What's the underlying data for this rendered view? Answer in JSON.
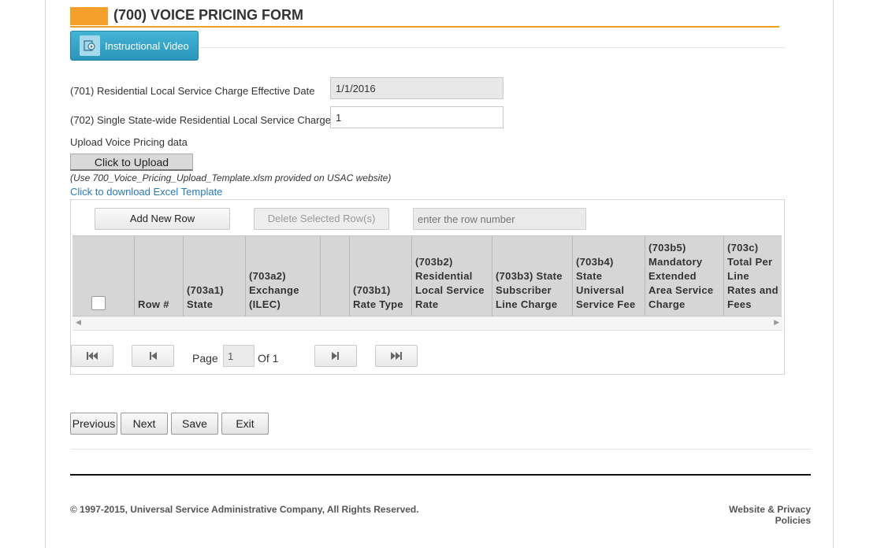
{
  "header": {
    "title": "(700) VOICE PRICING FORM",
    "video_button_label": "Instructional Video",
    "accent_color": "#f5a02a"
  },
  "fields": {
    "effective_date": {
      "label": "(701) Residential Local Service Charge Effective Date",
      "value": "1/1/2016"
    },
    "statewide_charge": {
      "label": "(702) Single State-wide Residential Local Service Charge",
      "value": "1"
    }
  },
  "upload": {
    "label": "Upload Voice Pricing data",
    "button_label": "Click to Upload",
    "hint": "(Use 700_Voice_Pricing_Upload_Template.xlsm provided on USAC website)",
    "download_link": "Click to download Excel Template",
    "link_color": "#2a7ab8"
  },
  "grid": {
    "add_row_label": "Add New Row",
    "delete_rows_label": "Delete Selected Row(s)",
    "row_number_placeholder": "enter the row number",
    "columns": [
      "",
      "Row #",
      "(703a1) State",
      "(703a2) Exchange (ILEC)",
      "",
      "(703b1) Rate Type",
      "(703b2) Residential Local Service Rate",
      "(703b3) State Subscriber Line Charge",
      "(703b4) State Universal Service Fee",
      "(703b5) Mandatory Extended Area Service Charge",
      "(703c) Total Per Line Rates and Fees"
    ],
    "pagination": {
      "page_label": "Page",
      "current_page": "1",
      "of_label": "Of 1"
    }
  },
  "nav": {
    "previous": "Previous",
    "next": "Next",
    "save": "Save",
    "exit": "Exit"
  },
  "footer": {
    "copyright": "© 1997-2015, Universal Service Administrative Company, All Rights Reserved.",
    "policies": "Website & Privacy Policies"
  }
}
